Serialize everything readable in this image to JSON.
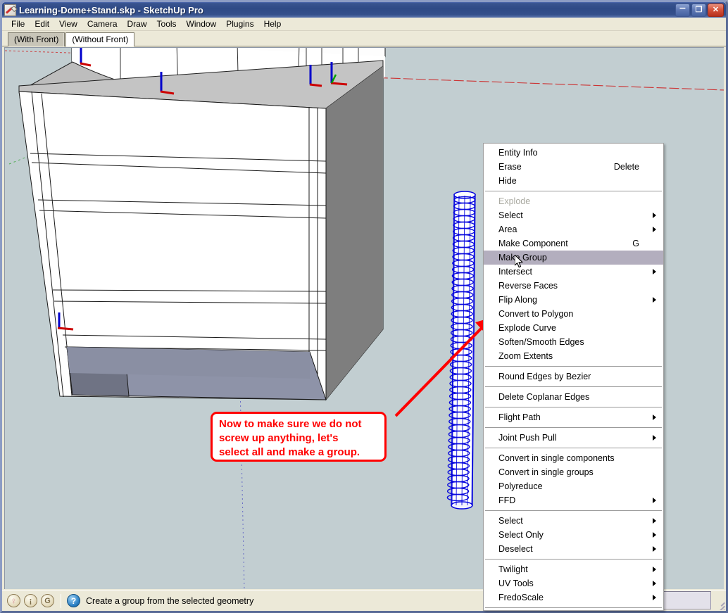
{
  "window": {
    "title": "Learning-Dome+Stand.skp  -  SketchUp Pro",
    "icon": "sketchup-app-icon",
    "buttons": {
      "minimize": "–",
      "maximize": "❐",
      "close": "✕"
    }
  },
  "menubar": {
    "items": [
      {
        "label": "File"
      },
      {
        "label": "Edit"
      },
      {
        "label": "View"
      },
      {
        "label": "Camera"
      },
      {
        "label": "Draw"
      },
      {
        "label": "Tools"
      },
      {
        "label": "Window"
      },
      {
        "label": "Plugins"
      },
      {
        "label": "Help"
      }
    ]
  },
  "scene_tabs": [
    {
      "label": "(With Front)",
      "active": true
    },
    {
      "label": "(Without Front)",
      "active": false
    }
  ],
  "context_menu": {
    "groups": [
      {
        "items": [
          {
            "label": "Entity Info",
            "accel": "",
            "submenu": false,
            "disabled": false,
            "selected": false
          },
          {
            "label": "Erase",
            "accel": "Delete",
            "submenu": false,
            "disabled": false,
            "selected": false
          },
          {
            "label": "Hide",
            "accel": "",
            "submenu": false,
            "disabled": false,
            "selected": false
          }
        ]
      },
      {
        "items": [
          {
            "label": "Explode",
            "accel": "",
            "submenu": false,
            "disabled": true,
            "selected": false
          },
          {
            "label": "Select",
            "accel": "",
            "submenu": true,
            "disabled": false,
            "selected": false
          },
          {
            "label": "Area",
            "accel": "",
            "submenu": true,
            "disabled": false,
            "selected": false
          },
          {
            "label": "Make Component",
            "accel": "G",
            "submenu": false,
            "disabled": false,
            "selected": false
          },
          {
            "label": "Make Group",
            "accel": "",
            "submenu": false,
            "disabled": false,
            "selected": true
          },
          {
            "label": "Intersect",
            "accel": "",
            "submenu": true,
            "disabled": false,
            "selected": false
          },
          {
            "label": "Reverse Faces",
            "accel": "",
            "submenu": false,
            "disabled": false,
            "selected": false
          },
          {
            "label": "Flip Along",
            "accel": "",
            "submenu": true,
            "disabled": false,
            "selected": false
          },
          {
            "label": "Convert to Polygon",
            "accel": "",
            "submenu": false,
            "disabled": false,
            "selected": false
          },
          {
            "label": "Explode Curve",
            "accel": "",
            "submenu": false,
            "disabled": false,
            "selected": false
          },
          {
            "label": "Soften/Smooth Edges",
            "accel": "",
            "submenu": false,
            "disabled": false,
            "selected": false
          },
          {
            "label": "Zoom Extents",
            "accel": "",
            "submenu": false,
            "disabled": false,
            "selected": false
          }
        ]
      },
      {
        "items": [
          {
            "label": "Round Edges by Bezier",
            "accel": "",
            "submenu": false,
            "disabled": false,
            "selected": false
          }
        ]
      },
      {
        "items": [
          {
            "label": "Delete Coplanar Edges",
            "accel": "",
            "submenu": false,
            "disabled": false,
            "selected": false
          }
        ]
      },
      {
        "items": [
          {
            "label": "Flight Path",
            "accel": "",
            "submenu": true,
            "disabled": false,
            "selected": false
          }
        ]
      },
      {
        "items": [
          {
            "label": "Joint Push Pull",
            "accel": "",
            "submenu": true,
            "disabled": false,
            "selected": false
          }
        ]
      },
      {
        "items": [
          {
            "label": "Convert in single components",
            "accel": "",
            "submenu": false,
            "disabled": false,
            "selected": false
          },
          {
            "label": "Convert in single groups",
            "accel": "",
            "submenu": false,
            "disabled": false,
            "selected": false
          },
          {
            "label": "Polyreduce",
            "accel": "",
            "submenu": false,
            "disabled": false,
            "selected": false
          },
          {
            "label": "FFD",
            "accel": "",
            "submenu": true,
            "disabled": false,
            "selected": false
          }
        ]
      },
      {
        "items": [
          {
            "label": "Select",
            "accel": "",
            "submenu": true,
            "disabled": false,
            "selected": false
          },
          {
            "label": "Select Only",
            "accel": "",
            "submenu": true,
            "disabled": false,
            "selected": false
          },
          {
            "label": "Deselect",
            "accel": "",
            "submenu": true,
            "disabled": false,
            "selected": false
          }
        ]
      },
      {
        "items": [
          {
            "label": "Twilight",
            "accel": "",
            "submenu": true,
            "disabled": false,
            "selected": false
          },
          {
            "label": "UV Tools",
            "accel": "",
            "submenu": true,
            "disabled": false,
            "selected": false
          },
          {
            "label": "FredoScale",
            "accel": "",
            "submenu": true,
            "disabled": false,
            "selected": false
          }
        ]
      }
    ]
  },
  "callout": {
    "lines": [
      "Now to make sure we do not",
      "screw up anything, let's",
      "select all and make a group."
    ],
    "color": "#ff0000"
  },
  "statusbar": {
    "icons": [
      {
        "name": "geo-location-icon",
        "glyph": "♀"
      },
      {
        "name": "geo-person-icon",
        "glyph": "¡"
      },
      {
        "name": "google-g-icon",
        "glyph": "G"
      }
    ],
    "help_icon": "?",
    "message": "Create a group from the selected geometry"
  },
  "viewport": {
    "background_color": "#c2ced1",
    "selection_color": "#0000ff",
    "axis_red": "#cc0000",
    "axis_green": "#00a000",
    "axis_blue": "#0000cc",
    "model_name": "dome stand with selected cylinder rod"
  }
}
